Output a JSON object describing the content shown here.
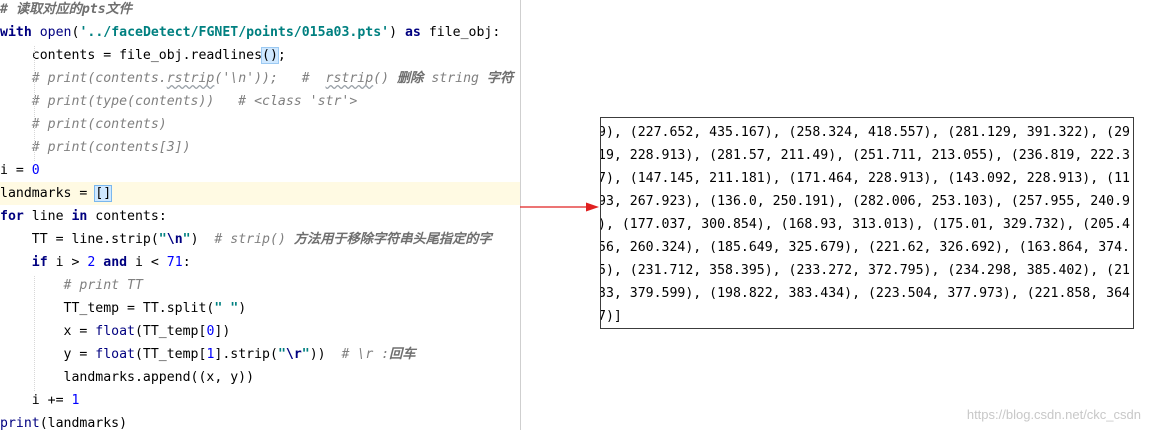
{
  "editor": {
    "lines": [
      {
        "tokens": [
          {
            "t": "# 读取对应的pts文件",
            "c": "cmtb"
          }
        ]
      },
      {
        "tokens": [
          {
            "t": "with",
            "c": "kw"
          },
          {
            "t": " "
          },
          {
            "t": "open",
            "c": "bi"
          },
          {
            "t": "("
          },
          {
            "t": "'../faceDetect/FGNET/points/015a03.pts'",
            "c": "str"
          },
          {
            "t": ") "
          },
          {
            "t": "as",
            "c": "kw"
          },
          {
            "t": " file_obj:"
          }
        ]
      },
      {
        "tokens": [
          {
            "t": "    contents = file_obj.readlines"
          },
          {
            "t": "()",
            "c": "paren-hl"
          },
          {
            "t": ";"
          }
        ]
      },
      {
        "tokens": [
          {
            "t": "    # print(contents.",
            "c": "cmt"
          },
          {
            "t": "rstrip",
            "c": "cmt wavy"
          },
          {
            "t": "('\\n'));   #  ",
            "c": "cmt"
          },
          {
            "t": "rstrip",
            "c": "cmt wavy"
          },
          {
            "t": "() ",
            "c": "cmt"
          },
          {
            "t": "删除",
            "c": "cmtb"
          },
          {
            "t": " string ",
            "c": "cmt"
          },
          {
            "t": "字符",
            "c": "cmtb"
          }
        ]
      },
      {
        "tokens": [
          {
            "t": "    # print(type(contents))   # <class 'str'>",
            "c": "cmt"
          }
        ]
      },
      {
        "tokens": [
          {
            "t": "    # print(contents)",
            "c": "cmt"
          }
        ]
      },
      {
        "tokens": [
          {
            "t": "    # print(contents[3])",
            "c": "cmt"
          }
        ]
      },
      {
        "tokens": [
          {
            "t": "i = "
          },
          {
            "t": "0",
            "c": "num"
          }
        ]
      },
      {
        "current": true,
        "tokens": [
          {
            "t": "landmarks = "
          },
          {
            "t": "[]",
            "c": "brk-hl"
          }
        ]
      },
      {
        "tokens": [
          {
            "t": "for",
            "c": "kw"
          },
          {
            "t": " line "
          },
          {
            "t": "in",
            "c": "kw"
          },
          {
            "t": " contents:"
          }
        ]
      },
      {
        "tokens": [
          {
            "t": "    TT = line.strip("
          },
          {
            "t": "\"",
            "c": "str"
          },
          {
            "t": "\\n",
            "c": "esc"
          },
          {
            "t": "\"",
            "c": "str"
          },
          {
            "t": ")  "
          },
          {
            "t": "# strip() ",
            "c": "cmt"
          },
          {
            "t": "方法用于移除字符串头尾指定的字",
            "c": "cmtb"
          }
        ]
      },
      {
        "tokens": [
          {
            "t": "    "
          },
          {
            "t": "if",
            "c": "kw"
          },
          {
            "t": " i > "
          },
          {
            "t": "2",
            "c": "num"
          },
          {
            "t": " "
          },
          {
            "t": "and",
            "c": "kw"
          },
          {
            "t": " i < "
          },
          {
            "t": "71",
            "c": "num"
          },
          {
            "t": ":"
          }
        ]
      },
      {
        "tokens": [
          {
            "t": "        # print TT",
            "c": "cmt"
          }
        ]
      },
      {
        "tokens": [
          {
            "t": "        TT_temp = TT.split("
          },
          {
            "t": "\" \"",
            "c": "str"
          },
          {
            "t": ")"
          }
        ]
      },
      {
        "tokens": [
          {
            "t": "        x = "
          },
          {
            "t": "float",
            "c": "bi"
          },
          {
            "t": "(TT_temp["
          },
          {
            "t": "0",
            "c": "num"
          },
          {
            "t": "])"
          }
        ]
      },
      {
        "tokens": [
          {
            "t": "        y = "
          },
          {
            "t": "float",
            "c": "bi"
          },
          {
            "t": "(TT_temp["
          },
          {
            "t": "1",
            "c": "num"
          },
          {
            "t": "].strip("
          },
          {
            "t": "\"",
            "c": "str"
          },
          {
            "t": "\\r",
            "c": "esc"
          },
          {
            "t": "\"",
            "c": "str"
          },
          {
            "t": "))  "
          },
          {
            "t": "# \\r :",
            "c": "cmt"
          },
          {
            "t": "回车",
            "c": "cmtb"
          }
        ]
      },
      {
        "tokens": [
          {
            "t": "        landmarks.append((x, y))"
          }
        ]
      },
      {
        "tokens": [
          {
            "t": "    i += "
          },
          {
            "t": "1",
            "c": "num"
          }
        ]
      },
      {
        "tokens": [
          {
            "t": "print",
            "c": "bi"
          },
          {
            "t": "(landmarks)"
          }
        ]
      }
    ]
  },
  "output": {
    "lines": [
      "9), (227.652, 435.167), (258.324, 418.557), (281.129, 391.322), (29",
      "19, 228.913), (281.57, 211.49), (251.711, 213.055), (236.819, 222.3",
      "7), (147.145, 211.181), (171.464, 228.913), (143.092, 228.913), (11",
      "93, 267.923), (136.0, 250.191), (282.006, 253.103), (257.955, 240.9",
      "), (177.037, 300.854), (168.93, 313.013), (175.01, 329.732), (205.4",
      "56, 260.324), (185.649, 325.679), (221.62, 326.692), (163.864, 374.",
      "5), (231.712, 358.395), (233.272, 372.795), (234.298, 385.402), (21",
      "33, 379.599), (198.822, 383.434), (223.504, 377.973), (221.858, 364",
      "7)]"
    ]
  },
  "watermark": "https://blog.csdn.net/ckc_csdn",
  "colors": {
    "keyword": "#000080",
    "string": "#008080",
    "number": "#0000ff",
    "comment": "#808080",
    "current_line": "#fffae3",
    "arrow": "#e02020"
  }
}
